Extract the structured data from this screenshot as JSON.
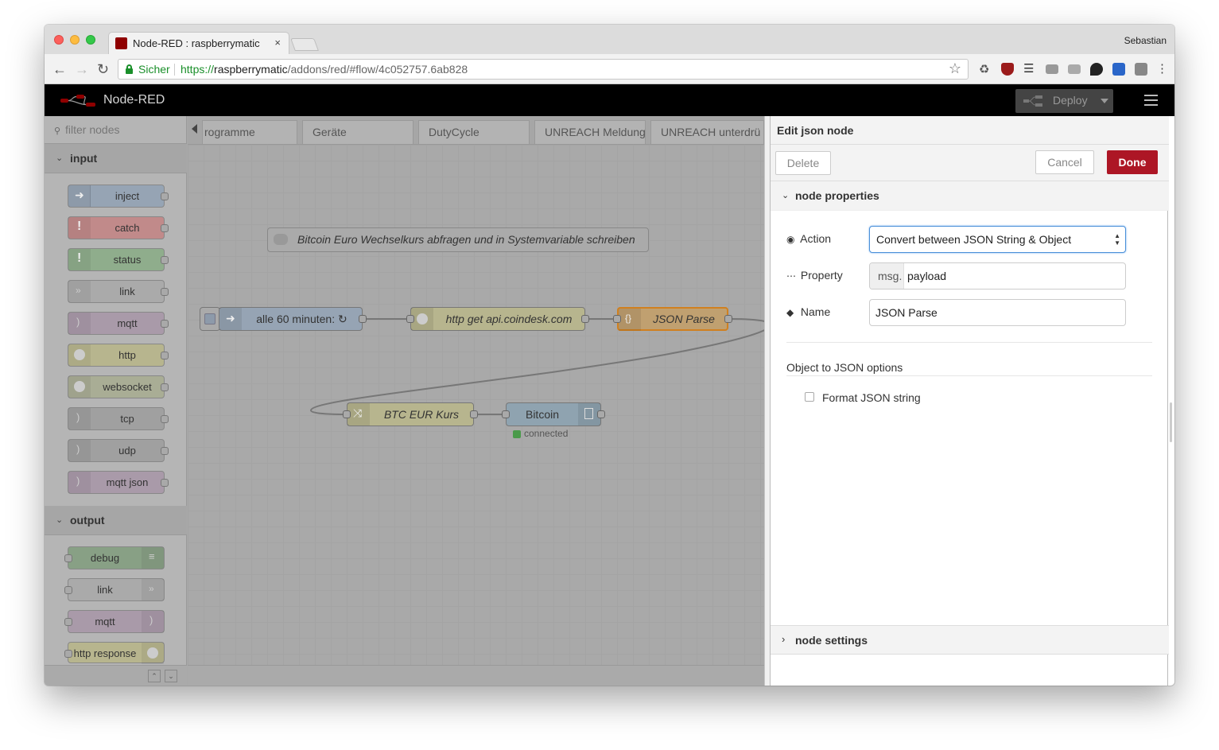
{
  "browser": {
    "tab_title": "Node-RED : raspberrymatic",
    "tab_close": "×",
    "profile_name": "Sebastian",
    "security_label": "Sicher",
    "url_scheme": "https://",
    "url_host": "raspberrymatic",
    "url_path": "/addons/red/#flow/4c052757.6ab828",
    "nav_icons": [
      "back-arrow-icon",
      "forward-arrow-icon",
      "reload-icon",
      "star-icon"
    ],
    "extension_icons": [
      "recycle-icon",
      "ublock-icon",
      "list-icon",
      "camera-icon",
      "tab-icon",
      "pin-icon",
      "info-icon",
      "jb-icon",
      "more-icon"
    ]
  },
  "header": {
    "title": "Node-RED",
    "deploy_label": "Deploy"
  },
  "palette": {
    "filter_placeholder": "filter nodes",
    "categories": [
      {
        "label": "input",
        "nodes": [
          "inject",
          "catch",
          "status",
          "link",
          "mqtt",
          "http",
          "websocket",
          "tcp",
          "udp",
          "mqtt json"
        ]
      },
      {
        "label": "output",
        "nodes": [
          "debug",
          "link",
          "mqtt",
          "http response"
        ]
      }
    ]
  },
  "workspace": {
    "tabs": [
      "rogramme",
      "Geräte",
      "DutyCycle",
      "UNREACH Meldung",
      "UNREACH unterdrü"
    ],
    "comment": "Bitcoin Euro Wechselkurs abfragen und in Systemvariable schreiben",
    "nodes": {
      "inject": "alle 60 minuten: ↻",
      "http": "http get api.coindesk.com",
      "json": "JSON Parse",
      "change": "BTC EUR Kurs",
      "bitcoin": "Bitcoin",
      "bitcoin_status": "connected"
    }
  },
  "tray": {
    "title": "Edit json node",
    "delete_label": "Delete",
    "cancel_label": "Cancel",
    "done_label": "Done",
    "section_properties": "node properties",
    "action_label": "Action",
    "action_value": "Convert between JSON String & Object",
    "property_label": "Property",
    "property_type": "msg.",
    "property_value": "payload",
    "name_label": "Name",
    "name_value": "JSON Parse",
    "options_title": "Object to JSON options",
    "format_label": "Format JSON string",
    "format_checked": false,
    "section_settings": "node settings"
  },
  "colors": {
    "done_button": "#ad1625",
    "header_bg": "#000000",
    "secure_green": "#1a8f2a"
  }
}
